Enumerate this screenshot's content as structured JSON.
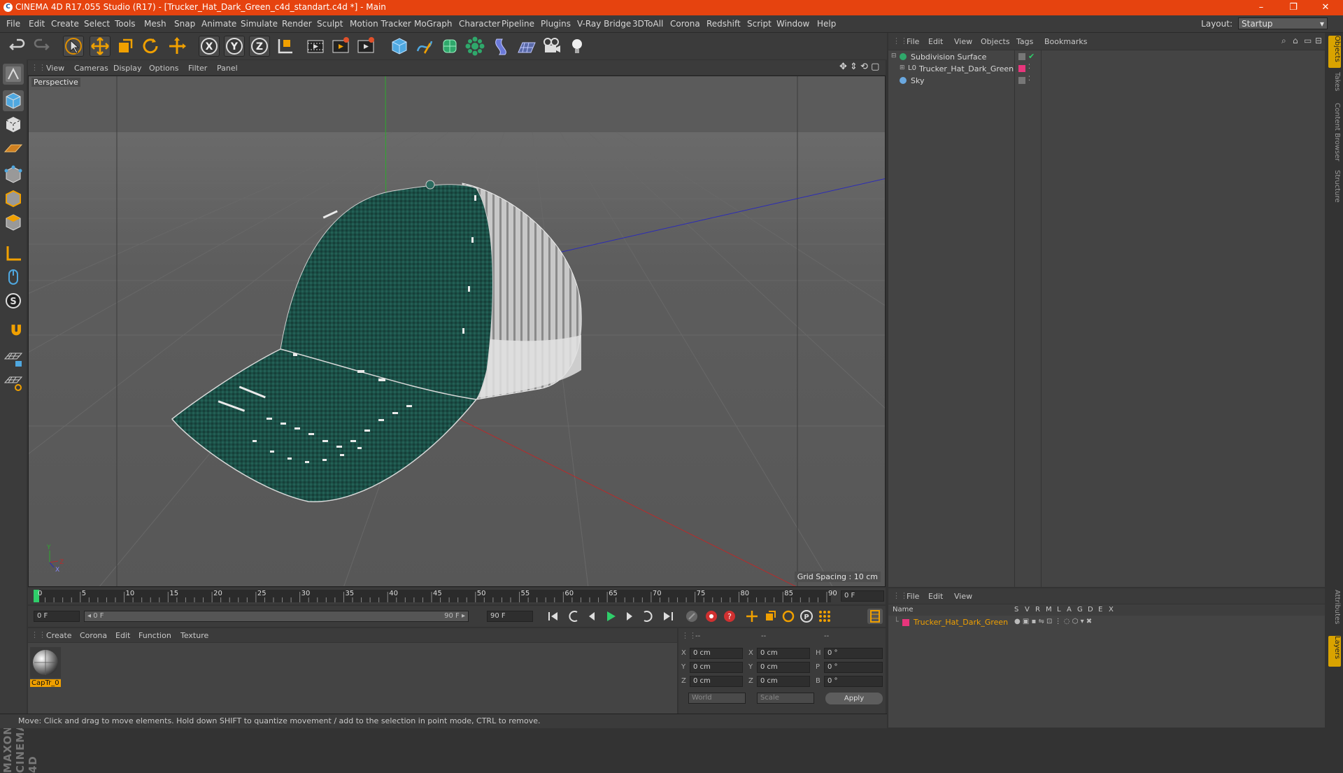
{
  "window": {
    "title": "CINEMA 4D R17.055 Studio (R17) - [Trucker_Hat_Dark_Green_c4d_standart.c4d *] - Main",
    "controls": [
      "–",
      "❐",
      "✕"
    ]
  },
  "menubar": {
    "items": [
      "File",
      "Edit",
      "Create",
      "Select",
      "Tools",
      "Mesh",
      "Snap",
      "Animate",
      "Simulate",
      "Render",
      "Sculpt",
      "Motion Tracker",
      "MoGraph",
      "Character",
      "Pipeline",
      "Plugins",
      "V-Ray Bridge",
      "3DToAll",
      "Corona",
      "Redshift",
      "Script",
      "Window",
      "Help"
    ],
    "layout_label": "Layout:",
    "layout_value": "Startup"
  },
  "viewport": {
    "menu": [
      "View",
      "Cameras",
      "Display",
      "Options",
      "Filter",
      "Panel"
    ],
    "camera_label": "Perspective",
    "grid_spacing": "Grid Spacing : 10 cm"
  },
  "timeline": {
    "ticks": [
      "0",
      "5",
      "10",
      "15",
      "20",
      "25",
      "30",
      "35",
      "40",
      "45",
      "50",
      "55",
      "60",
      "65",
      "70",
      "75",
      "80",
      "85",
      "90"
    ],
    "current_frame": "0 F"
  },
  "transport": {
    "start_field": "0 F",
    "range_start": "◂ 0 F",
    "range_end": "90 F ▸",
    "end_field": "90 F"
  },
  "material_manager": {
    "menu": [
      "Create",
      "Corona",
      "Edit",
      "Function",
      "Texture"
    ],
    "materials": [
      {
        "name": "CapTr_0"
      }
    ]
  },
  "coordinates": {
    "headers": [
      "--",
      "--",
      "--"
    ],
    "rows": [
      {
        "l1": "X",
        "v1": "0 cm",
        "l2": "X",
        "v2": "0 cm",
        "l3": "H",
        "v3": "0 °"
      },
      {
        "l1": "Y",
        "v1": "0 cm",
        "l2": "Y",
        "v2": "0 cm",
        "l3": "P",
        "v3": "0 °"
      },
      {
        "l1": "Z",
        "v1": "0 cm",
        "l2": "Z",
        "v2": "0 cm",
        "l3": "B",
        "v3": "0 °"
      }
    ],
    "world": "World",
    "scale": "Scale",
    "apply": "Apply"
  },
  "status": "Move: Click and drag to move elements. Hold down SHIFT to quantize movement / add to the selection in point mode, CTRL to remove.",
  "object_manager": {
    "menu": [
      "File",
      "Edit",
      "View",
      "Objects",
      "Tags",
      "Bookmarks"
    ],
    "objects": [
      {
        "name": "Subdivision Surface",
        "indent": 0
      },
      {
        "name": "Trucker_Hat_Dark_Green",
        "indent": 1
      },
      {
        "name": "Sky",
        "indent": 0
      }
    ]
  },
  "layer_manager": {
    "menu": [
      "File",
      "Edit",
      "View"
    ],
    "columns": [
      "Name",
      "S",
      "V",
      "R",
      "M",
      "L",
      "A",
      "G",
      "D",
      "E",
      "X"
    ],
    "layers": [
      {
        "name": "Trucker_Hat_Dark_Green"
      }
    ]
  },
  "right_tabs": [
    "Objects",
    "Takes",
    "Content Browser",
    "Structure"
  ],
  "right_tabs_lower": [
    "Attributes",
    "Layers"
  ],
  "maxon_logo": "MAXON CINEMA 4D",
  "colors": {
    "titlebar": "#e6430f",
    "accent": "#f0a000",
    "layer_pink": "#e8357c"
  }
}
